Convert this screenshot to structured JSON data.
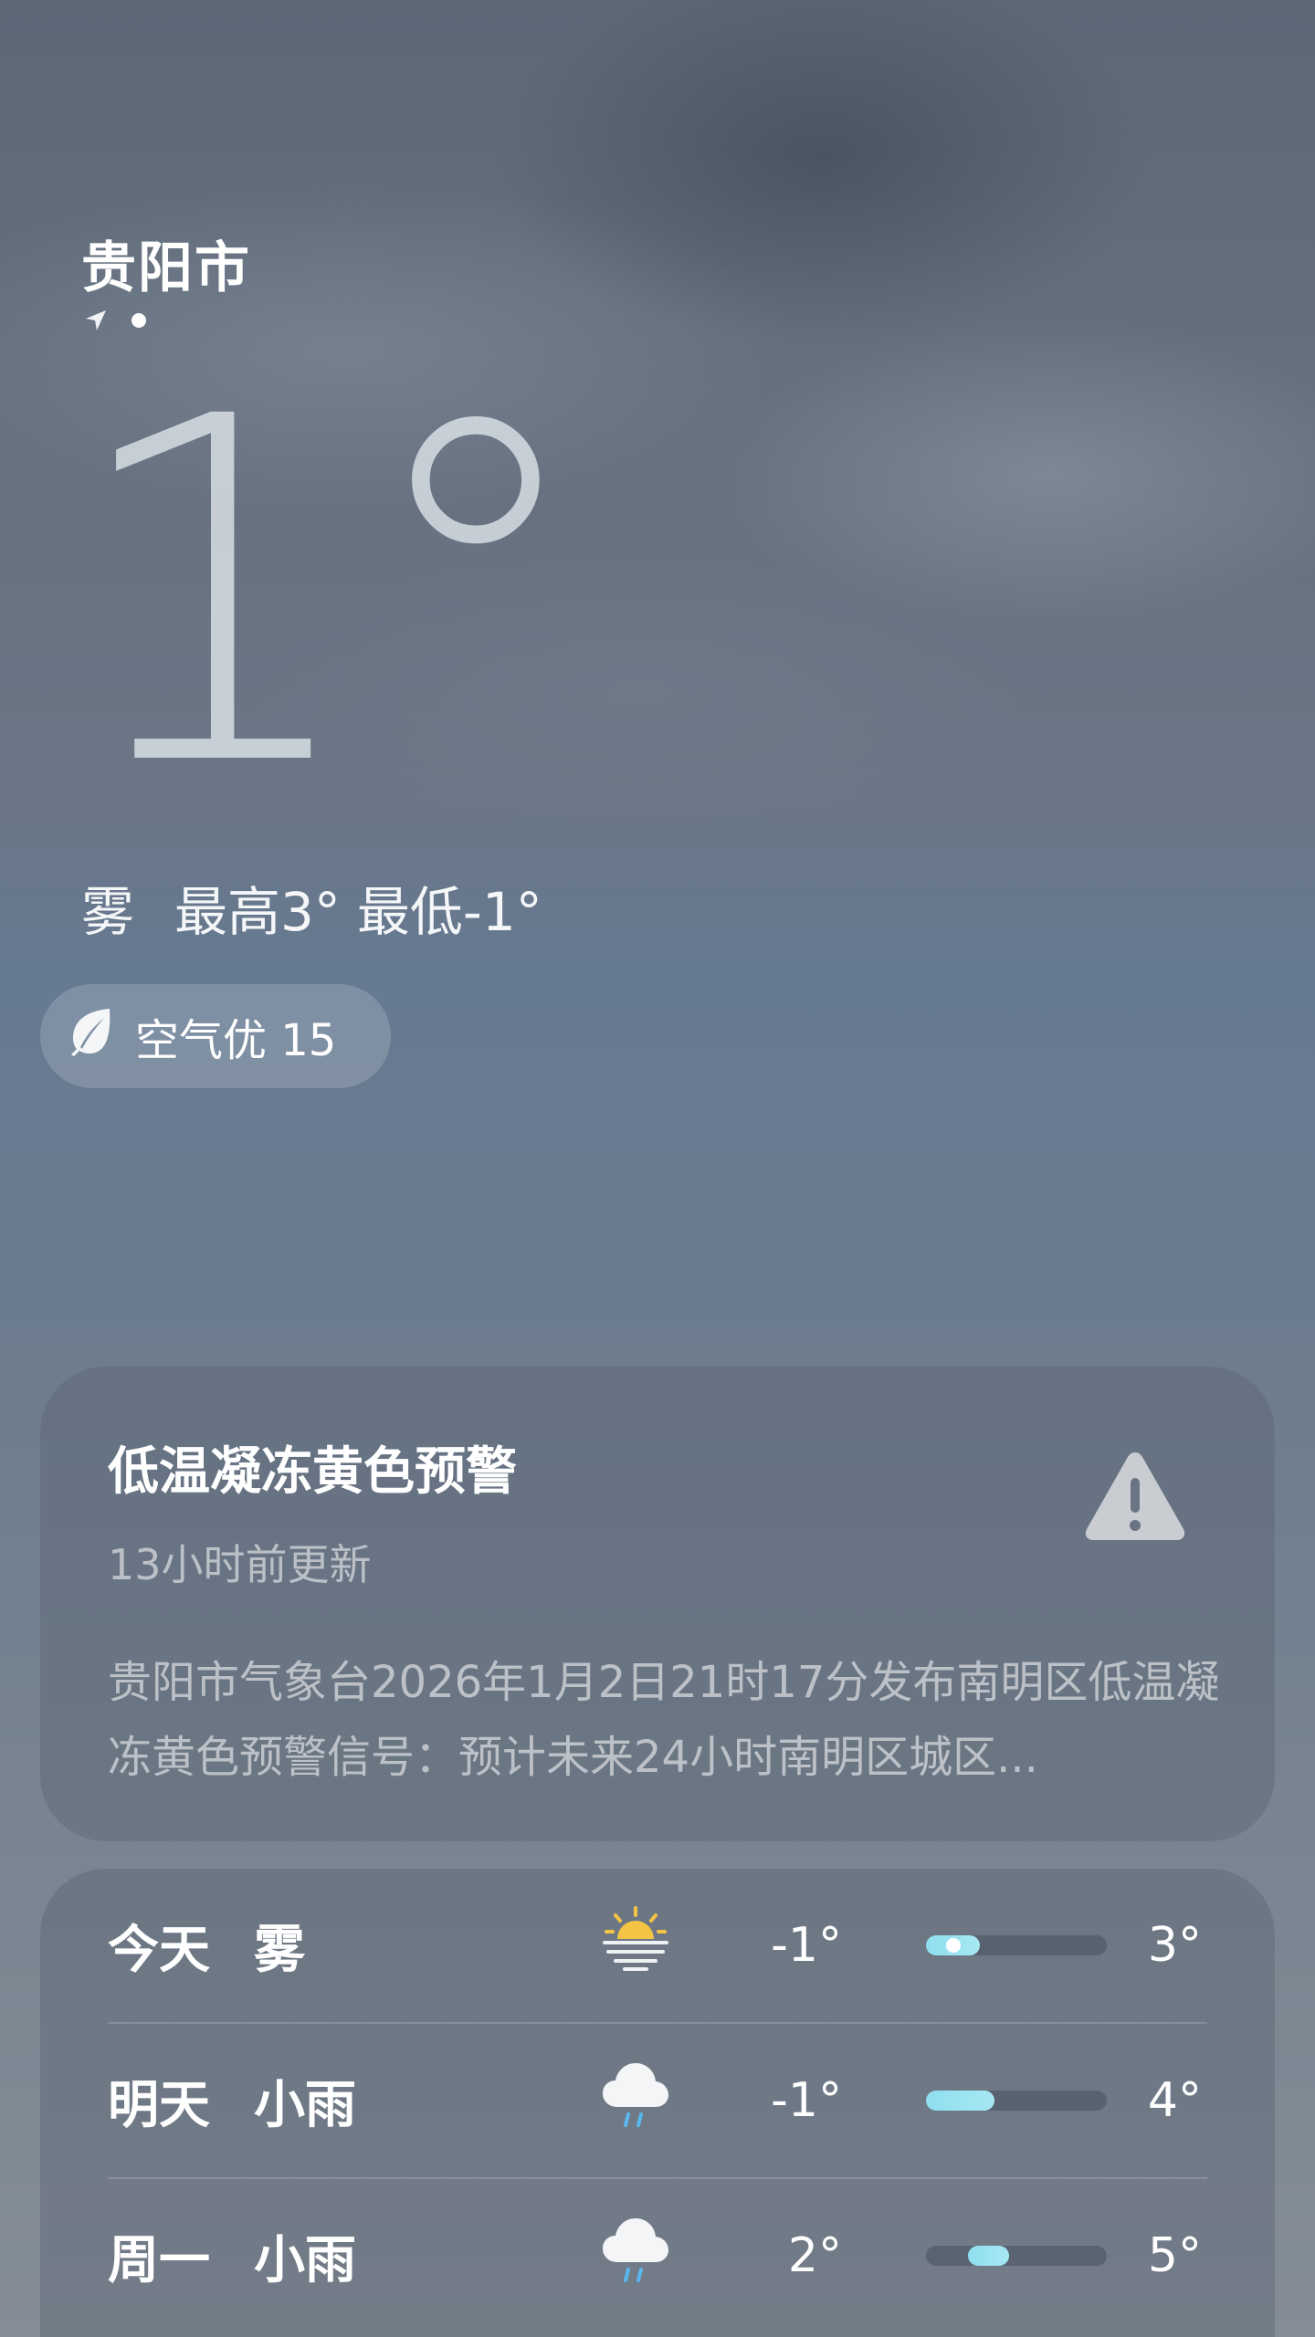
{
  "location": {
    "city": "贵阳市"
  },
  "current": {
    "temperature": "1°",
    "summary_condition": "雾",
    "summary_high": "最高3°",
    "summary_low": "最低-1°"
  },
  "air_quality": {
    "label": "空气优 15",
    "icon": "leaf-icon"
  },
  "alert": {
    "title": "低温凝冻黄色预警",
    "updated": "13小时前更新",
    "body": "贵阳市气象台2026年1月2日21时17分发布南明区低温凝冻黄色预警信号：预计未来24小时南明区城区...",
    "icon": "warning-triangle-icon"
  },
  "forecast": [
    {
      "day": "今天",
      "condition": "雾",
      "icon": "fog-sun-icon",
      "low": "-1°",
      "high": "3°",
      "range_start": 0.0,
      "range_end": 0.3,
      "now_position": 0.15
    },
    {
      "day": "明天",
      "condition": "小雨",
      "icon": "light-rain-icon",
      "low": "-1°",
      "high": "4°",
      "range_start": 0.0,
      "range_end": 0.38
    },
    {
      "day": "周一",
      "condition": "小雨",
      "icon": "light-rain-icon",
      "low": "2°",
      "high": "5°",
      "range_start": 0.23,
      "range_end": 0.46
    }
  ],
  "colors": {
    "accent_bar": "#8fdff0",
    "warning_icon": "#c9ccd1"
  }
}
